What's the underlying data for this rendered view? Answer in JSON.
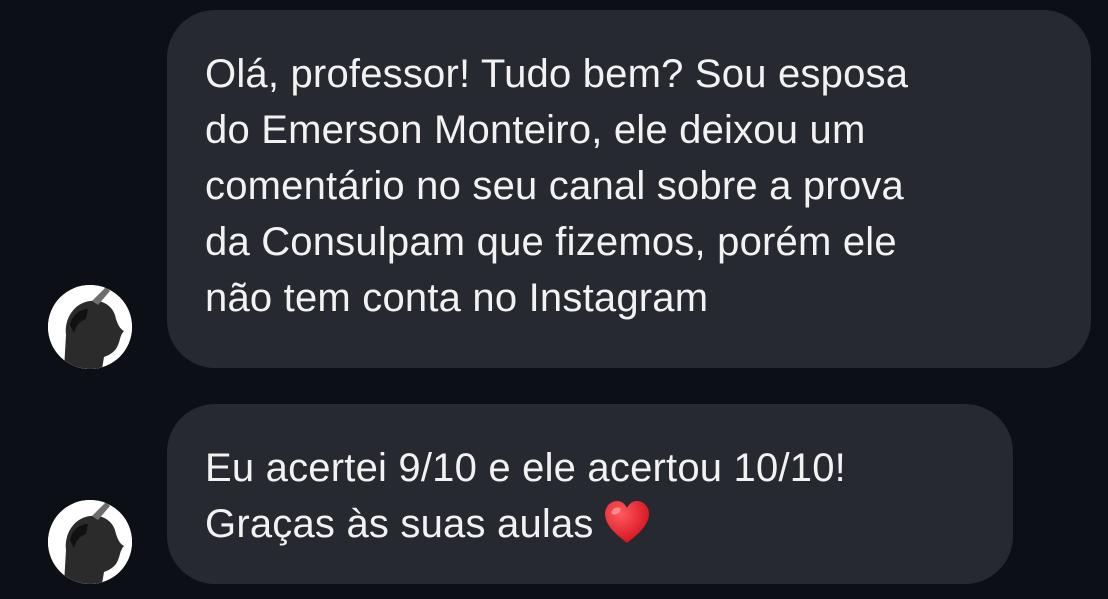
{
  "messages": [
    {
      "text": "Olá, professor! Tudo bem? Sou esposa\ndo Emerson Monteiro, ele deixou um\ncomentário no seu canal sobre a prova\nda Consulpam que fizemos, porém ele\nnão tem conta no Instagram"
    },
    {
      "text": "Eu acertei 9/10 e ele acertou 10/10!\nGraças às suas aulas",
      "emoji": "heart-icon"
    }
  ],
  "colors": {
    "background": "#0c0f15",
    "bubble": "#262930",
    "text": "#f2f2f2",
    "heart": "#e0202a"
  }
}
